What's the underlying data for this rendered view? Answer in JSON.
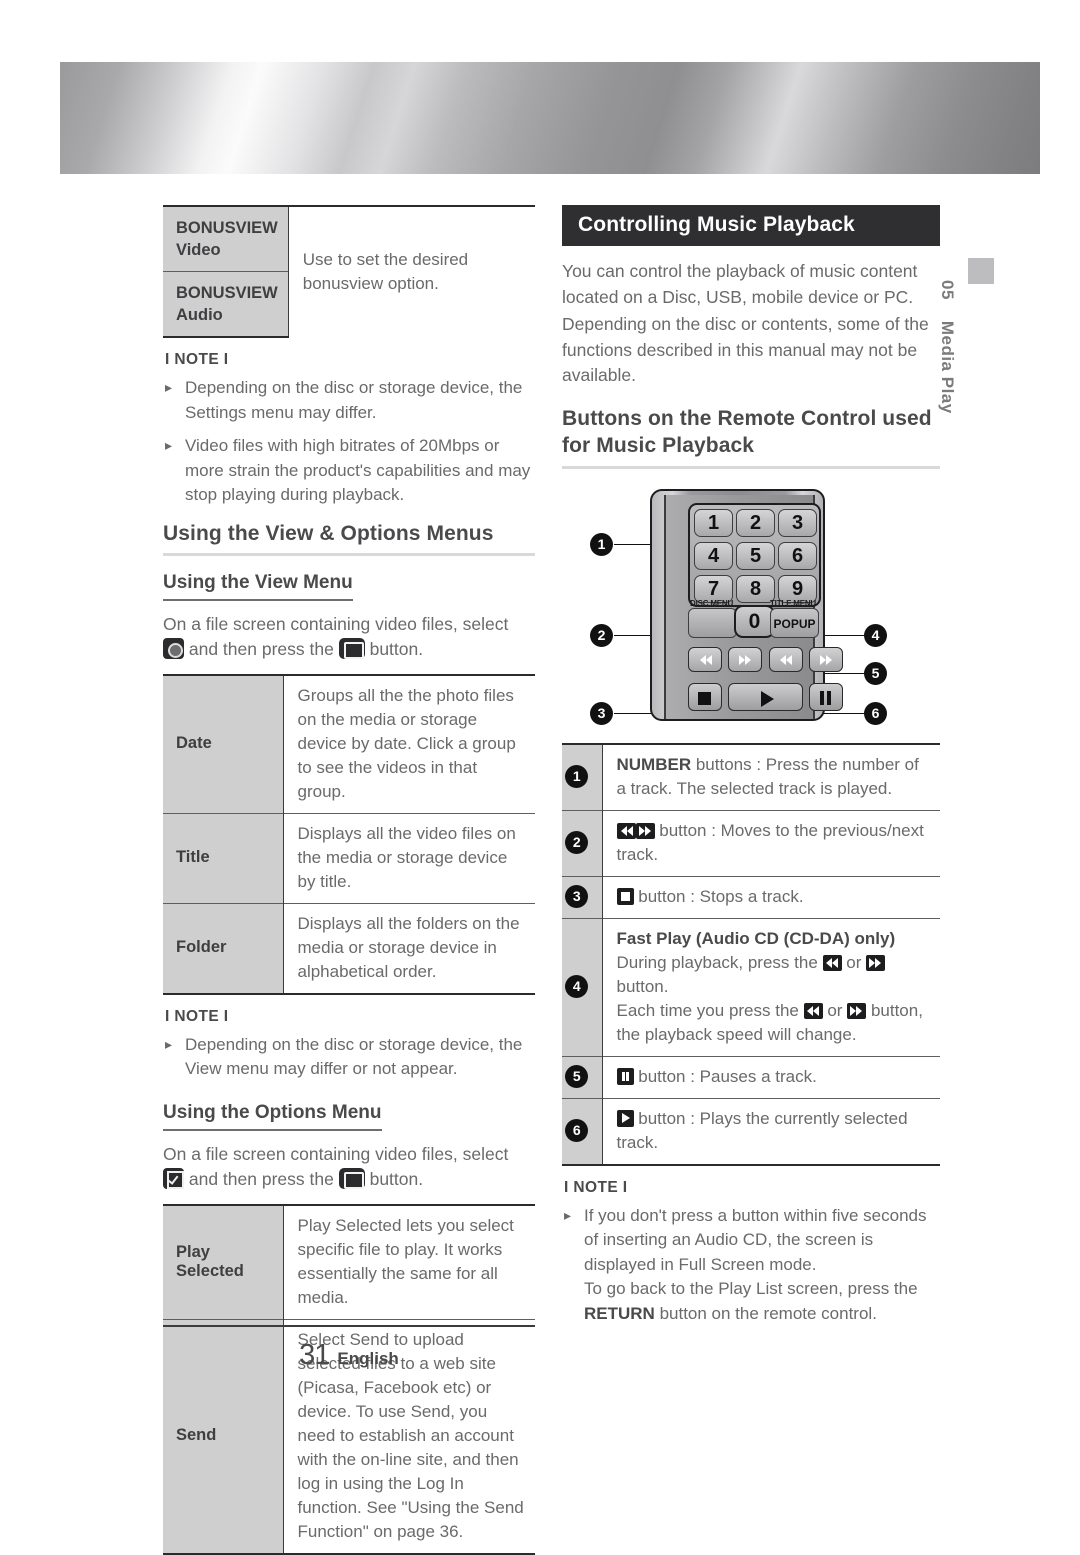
{
  "page": {
    "number": "31",
    "language": "English"
  },
  "sidebar": {
    "chapter_number": "05",
    "chapter_title": "Media Play"
  },
  "left": {
    "bonusview_table": {
      "rows": [
        {
          "label_line1": "BONUSVIEW",
          "label_line2": "Video"
        },
        {
          "label_line1": "BONUSVIEW",
          "label_line2": "Audio"
        }
      ],
      "description": "Use to set the desired bonusview option."
    },
    "note1": {
      "title": "I NOTE I",
      "items": [
        "Depending on the disc or storage device, the Settings menu may differ.",
        "Video files with high bitrates of 20Mbps or more strain the product's capabilities and may stop playing during playback."
      ]
    },
    "heading_view_options": "Using the View & Options Menus",
    "view_menu": {
      "heading": "Using the View Menu",
      "intro_part1": "On a file screen containing video files, select",
      "intro_part2": "and then press the",
      "intro_part3": "button.",
      "view_icon": "view-icon",
      "enter_icon": "enter-icon",
      "rows": [
        {
          "label": "Date",
          "desc": "Groups all the the photo files on the media or storage device by date. Click a group to see the videos in that group."
        },
        {
          "label": "Title",
          "desc": "Displays all the video files on the media or storage device by title."
        },
        {
          "label": "Folder",
          "desc": "Displays all the folders on the media or storage device in alphabetical order."
        }
      ]
    },
    "note2": {
      "title": "I NOTE I",
      "items": [
        "Depending on the disc or storage device, the View menu may differ or not appear."
      ]
    },
    "options_menu": {
      "heading": "Using the Options Menu",
      "intro_part1": "On a file screen containing video files, select",
      "intro_part2": "and then press the",
      "intro_part3": "button.",
      "options_icon": "options-icon",
      "enter_icon": "enter-icon",
      "rows": [
        {
          "label": "Play Selected",
          "desc": "Play Selected lets you select specific file to play. It works essentially the same for all media."
        },
        {
          "label": "Send",
          "desc": "Select Send to upload selected files to a web site (Picasa, Facebook etc) or device. To use Send, you need to establish an account with the on-line site, and then log in using the Log In function. See \"Using the Send Function\" on page 36."
        }
      ]
    }
  },
  "right": {
    "section_title": "Controlling Music Playback",
    "intro_paragraph1": "You can control the playback of music content located on a Disc, USB, mobile device or PC.",
    "intro_paragraph2": "Depending on the disc or contents, some of the functions described in this manual may not be available.",
    "heading_buttons": "Buttons on the Remote Control used for Music Playback",
    "remote": {
      "number_keys": [
        "1",
        "2",
        "3",
        "4",
        "5",
        "6",
        "7",
        "8",
        "9"
      ],
      "zero_key": "0",
      "disc_menu_label": "DISC MENU",
      "title_menu_label": "TITLE MENU",
      "popup_label": "POPUP",
      "callouts": [
        "1",
        "2",
        "3",
        "4",
        "5",
        "6"
      ]
    },
    "legend": {
      "rows": [
        {
          "num": "1",
          "bold_prefix": "NUMBER",
          "text": " buttons : Press the number of a track. The selected track is played."
        },
        {
          "num": "2",
          "icons": [
            "prev-track-icon",
            "next-track-icon"
          ],
          "text": "button : Moves to the previous/next track."
        },
        {
          "num": "3",
          "icons": [
            "stop-icon"
          ],
          "text": "button : Stops a track."
        },
        {
          "num": "4",
          "sub_heading": "Fast Play (Audio CD (CD-DA) only)",
          "line1_a": "During playback, press the",
          "line1_b": "or",
          "line1_c": "button.",
          "line2_a": "Each time you press the",
          "line2_b": "or",
          "line2_c": "button, the playback speed will change.",
          "icons": [
            "rewind-icon",
            "fast-forward-icon"
          ]
        },
        {
          "num": "5",
          "icons": [
            "pause-icon"
          ],
          "text": "button : Pauses a track."
        },
        {
          "num": "6",
          "icons": [
            "play-icon"
          ],
          "text": "button : Plays the currently selected track."
        }
      ]
    },
    "note": {
      "title": "I NOTE I",
      "item_line1": "If you don't press a button within five seconds of inserting an Audio CD, the screen is displayed in Full Screen mode.",
      "item_line2_a": "To go back to the Play List screen, press the ",
      "item_line2_bold": "RETURN",
      "item_line2_b": " button on the remote control."
    }
  }
}
